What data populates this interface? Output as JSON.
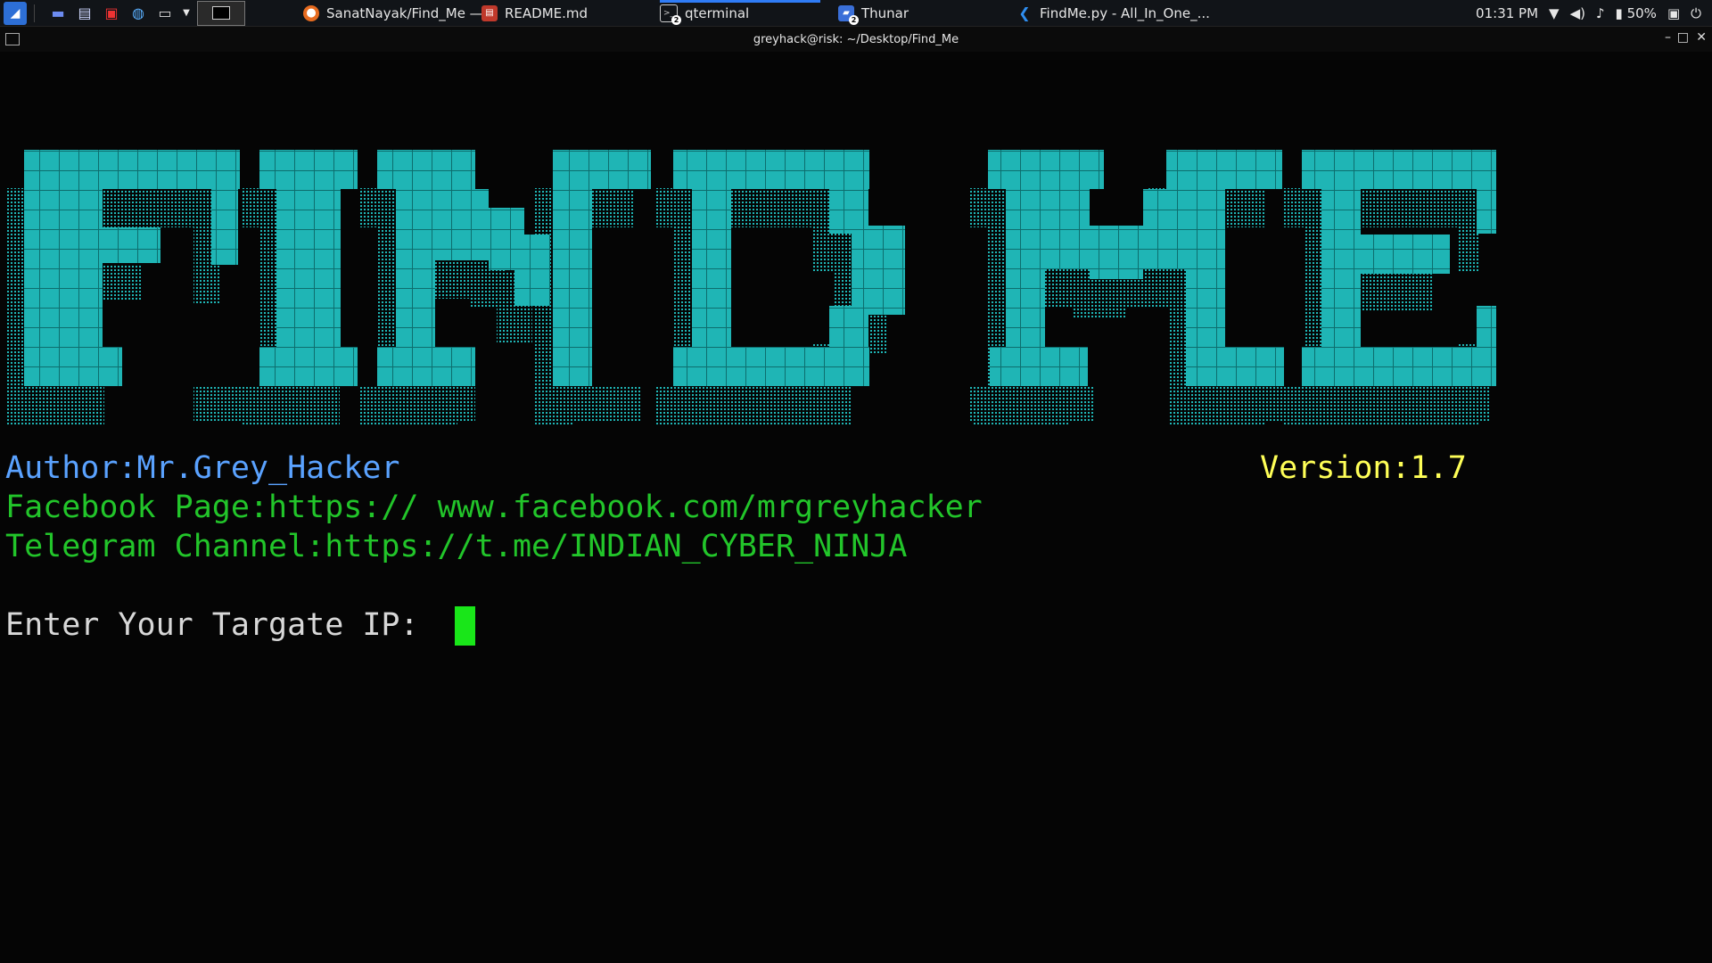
{
  "taskbar": {
    "launcher_icons": [
      "kali-menu-icon",
      "desktop-icon",
      "file-manager-icon",
      "text-editor-icon",
      "browser-icon",
      "terminal-icon"
    ],
    "tasks": [
      {
        "label": "SanatNayak/Find_Me —...",
        "icon": "firefox-icon"
      },
      {
        "label": "README.md",
        "icon": "document-icon"
      },
      {
        "label": "qterminal",
        "icon": "terminal-icon",
        "badge": "2"
      },
      {
        "label": "Thunar",
        "icon": "folder-icon",
        "badge": "2"
      },
      {
        "label": "FindMe.py - All_In_One_...",
        "icon": "vscode-icon"
      }
    ],
    "clock": "01:31 PM",
    "battery": "50%"
  },
  "window": {
    "title": "greyhack@risk: ~/Desktop/Find_Me"
  },
  "terminal": {
    "banner_text": "FIND ME",
    "author": "Author:Mr.Grey_Hacker",
    "version": "Version:1.7",
    "facebook": "Facebook Page:https:// www.facebook.com/mrgreyhacker",
    "telegram": "Telegram Channel:https://t.me/INDIAN_CYBER_NINJA",
    "prompt": "Enter Your Targate IP: "
  },
  "colors": {
    "banner": "#1fb5b5",
    "author": "#5aa2ff",
    "version": "#ffff57",
    "links": "#22c52a",
    "prompt": "#d8d8d8",
    "cursor": "#19e619"
  }
}
